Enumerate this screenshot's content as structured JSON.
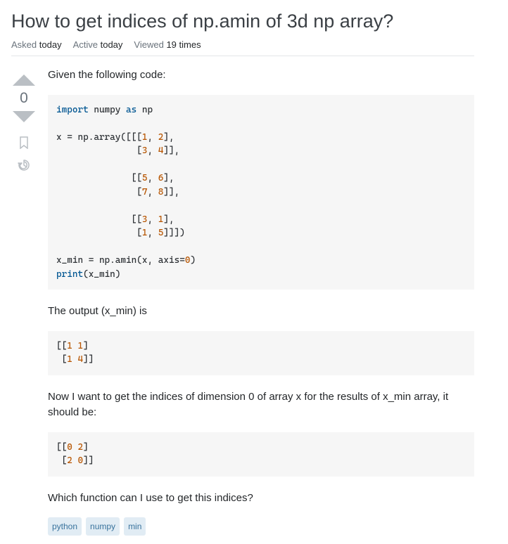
{
  "title": "How to get indices of np.amin of 3d np array?",
  "meta": {
    "asked_label": "Asked",
    "asked_value": "today",
    "active_label": "Active",
    "active_value": "today",
    "viewed_label": "Viewed",
    "viewed_value": "19 times"
  },
  "vote_count": "0",
  "body": {
    "p1": "Given the following code:",
    "p2": "The output (x_min) is",
    "p3": "Now I want to get the indices of dimension 0 of array x for the results of x_min array, it should be:",
    "p4": "Which function can I use to get this indices?"
  },
  "code": {
    "block1_plain": "import numpy as np\n\nx = np.array([[[1, 2],\n               [3, 4]],\n\n              [[5, 6],\n               [7, 8]],\n\n              [[3, 1],\n               [1, 5]]])\n\nx_min = np.amin(x, axis=0)\nprint(x_min)",
    "block2_plain": "[[1 1]\n [1 4]]",
    "block3_plain": "[[0 2]\n [2 0]]"
  },
  "tags": [
    "python",
    "numpy",
    "min"
  ]
}
